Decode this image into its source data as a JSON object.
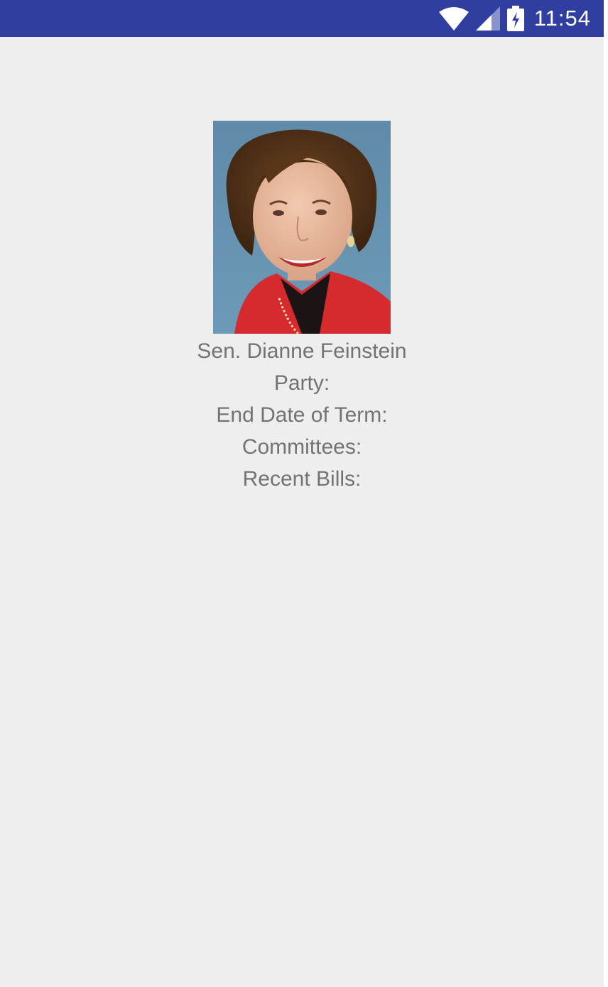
{
  "status_bar": {
    "time": "11:54",
    "icons": [
      "wifi-icon",
      "cell-signal-icon",
      "battery-charging-icon"
    ],
    "background": "#303f9f"
  },
  "senator": {
    "photo": "senator-portrait",
    "name": "Sen. Dianne Feinstein",
    "party_label": "Party:",
    "end_date_label": "End Date of Term:",
    "committees_label": "Committees:",
    "recent_bills_label": "Recent Bills:"
  },
  "colors": {
    "screen_background": "#eeeeee",
    "text": "#737373"
  }
}
